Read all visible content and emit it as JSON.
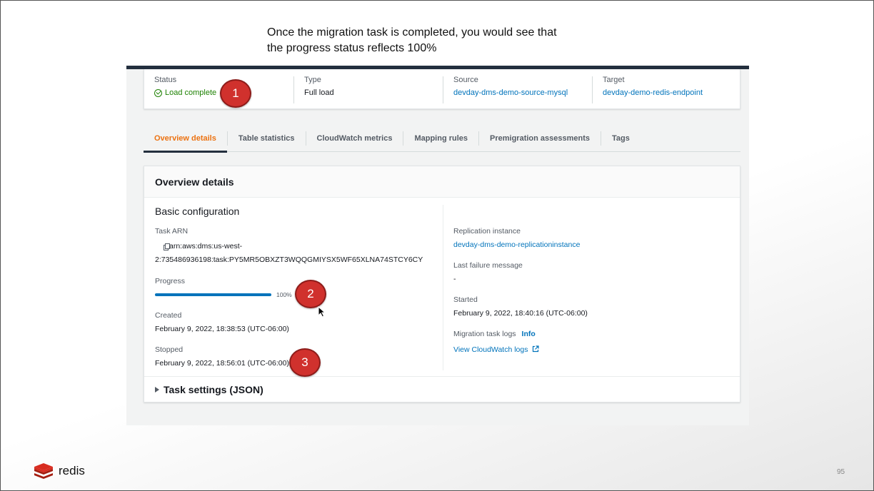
{
  "caption": {
    "line1": "Once the migration task is completed, you would see that",
    "line2": "the progress status reflects 100%"
  },
  "summary": {
    "status_label": "Status",
    "status_value": "Load complete",
    "type_label": "Type",
    "type_value": "Full load",
    "source_label": "Source",
    "source_value": "devday-dms-demo-source-mysql",
    "target_label": "Target",
    "target_value": "devday-demo-redis-endpoint"
  },
  "tabs": [
    {
      "label": "Overview details",
      "active": true
    },
    {
      "label": "Table statistics"
    },
    {
      "label": "CloudWatch metrics"
    },
    {
      "label": "Mapping rules"
    },
    {
      "label": "Premigration assessments"
    },
    {
      "label": "Tags"
    }
  ],
  "overview": {
    "title": "Overview details",
    "section_title": "Basic configuration",
    "task_arn_label": "Task ARN",
    "task_arn_line1": "arn:aws:dms:us-west-",
    "task_arn_line2": "2:735486936198:task:PY5MR5OBXZT3WQQGMIYSX5WF65XLNA74STCY6CY",
    "progress_label": "Progress",
    "progress_value": "100%",
    "progress_fraction": 1.0,
    "created_label": "Created",
    "created_value": "February 9, 2022, 18:38:53 (UTC-06:00)",
    "stopped_label": "Stopped",
    "stopped_value": "February 9, 2022, 18:56:01 (UTC-06:00)",
    "replication_label": "Replication instance",
    "replication_value": "devday-dms-demo-replicationinstance",
    "last_failure_label": "Last failure message",
    "last_failure_value": "-",
    "started_label": "Started",
    "started_value": "February 9, 2022, 18:40:16 (UTC-06:00)",
    "logs_label": "Migration task logs",
    "logs_info": "Info",
    "logs_link": "View CloudWatch logs",
    "task_settings": "Task settings (JSON)"
  },
  "badges": [
    "1",
    "2",
    "3"
  ],
  "footer": {
    "logo_text": "redis",
    "page_number": "95"
  },
  "colors": {
    "accent_tab": "#ec7211",
    "link": "#0073bb",
    "success": "#1d8102",
    "badge": "#d0312d",
    "header_bar": "#232f3e"
  }
}
